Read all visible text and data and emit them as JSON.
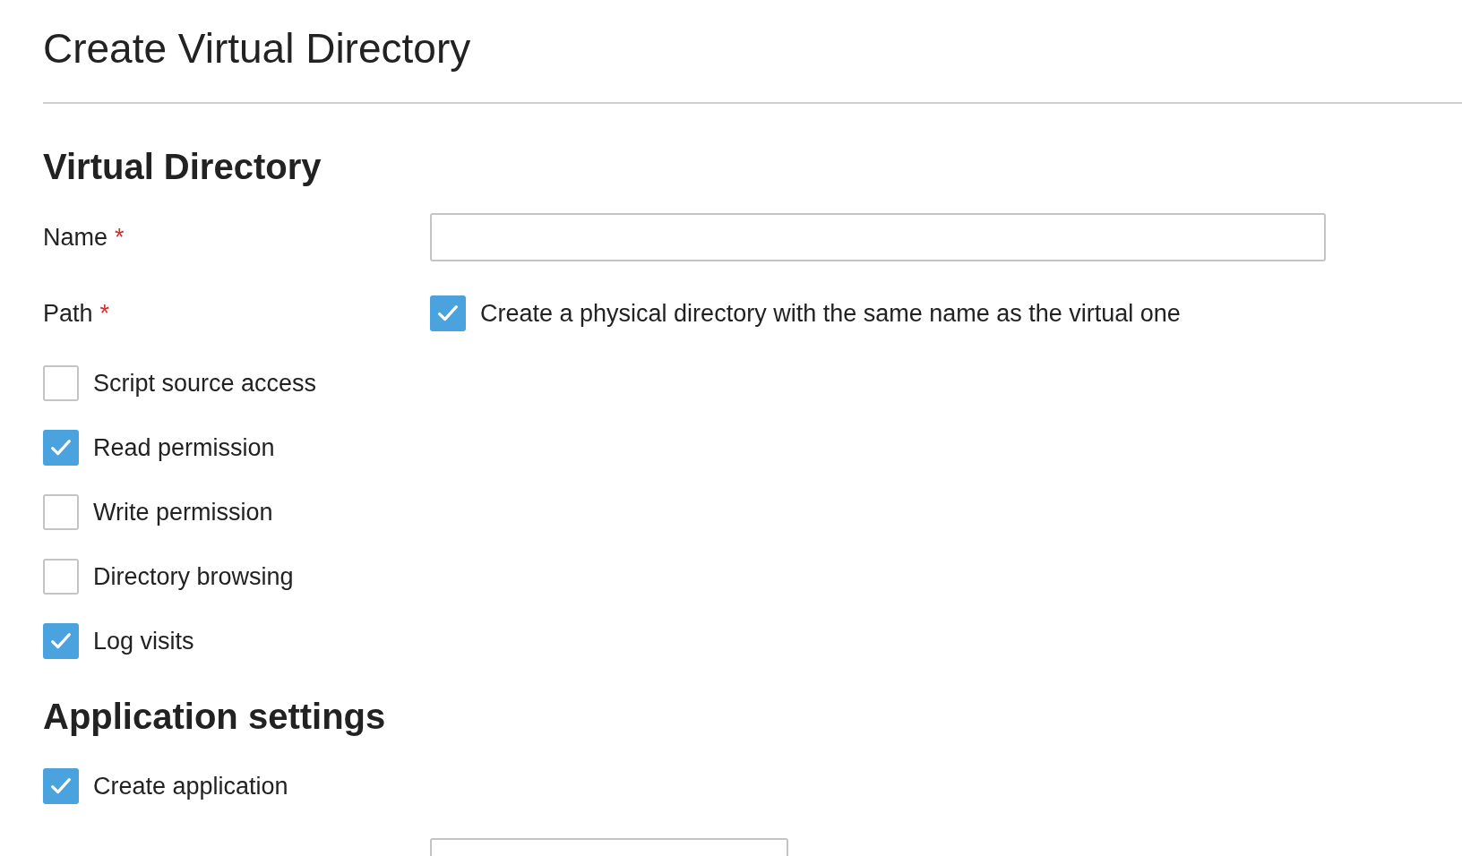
{
  "title": "Create Virtual Directory",
  "virtual_directory": {
    "heading": "Virtual Directory",
    "name": {
      "label": "Name",
      "required_mark": "*"
    },
    "path": {
      "label": "Path",
      "required_mark": "*",
      "option": {
        "label": "Create a physical directory with the same name as the virtual one",
        "checked": true
      }
    },
    "options": [
      {
        "label": "Script source access",
        "checked": false
      },
      {
        "label": "Read permission",
        "checked": true
      },
      {
        "label": "Write permission",
        "checked": false
      },
      {
        "label": "Directory browsing",
        "checked": false
      },
      {
        "label": "Log visits",
        "checked": true
      }
    ]
  },
  "application_settings": {
    "heading": "Application settings",
    "options": [
      {
        "label": "Create application",
        "checked": true
      }
    ]
  }
}
